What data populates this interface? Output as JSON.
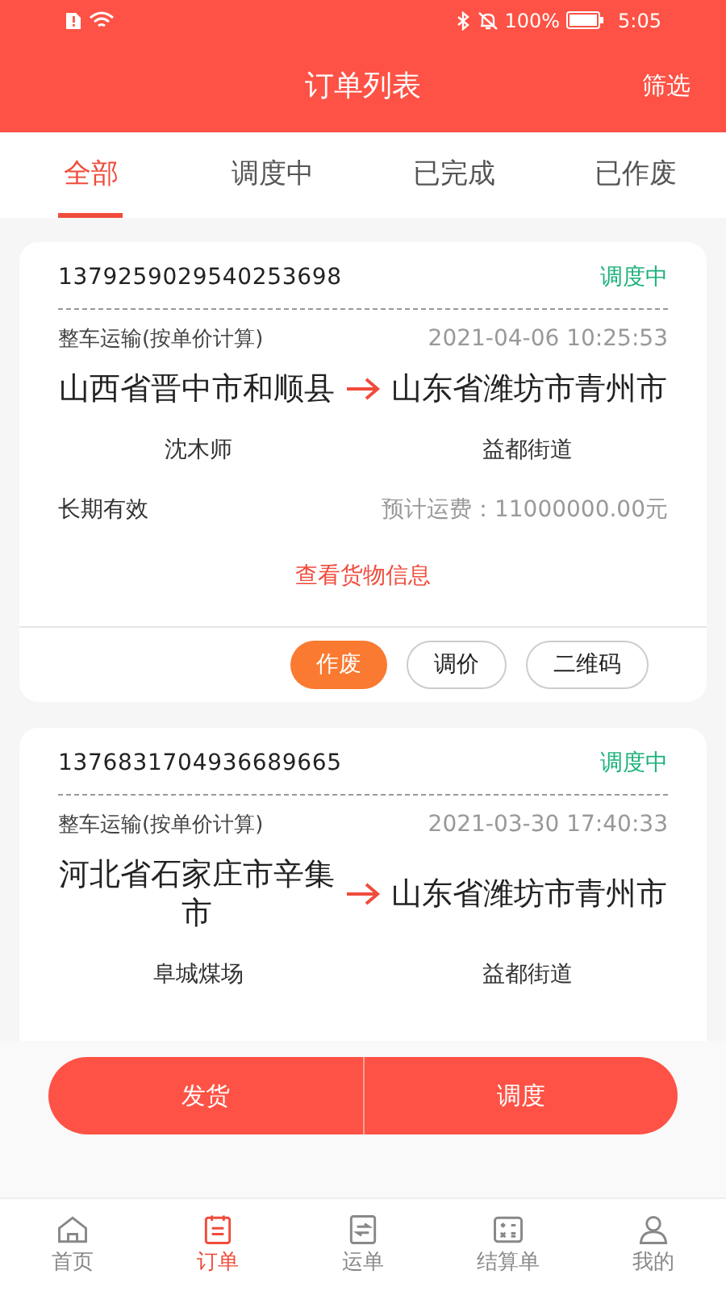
{
  "status_bar": {
    "battery": "100%",
    "time": "5:05"
  },
  "header": {
    "title": "订单列表",
    "action": "筛选"
  },
  "tabs": [
    {
      "label": "全部",
      "selected": true
    },
    {
      "label": "调度中",
      "selected": false
    },
    {
      "label": "已完成",
      "selected": false
    },
    {
      "label": "已作废",
      "selected": false
    }
  ],
  "orders": [
    {
      "number": "1379259029540253698",
      "status": "调度中",
      "type": "整车运输(按单价计算)",
      "time": "2021-04-06 10:25:53",
      "from": "山西省晋中市和顺县",
      "to": "山东省潍坊市青州市",
      "from_place": "沈木师",
      "to_place": "益都街道",
      "validity": "长期有效",
      "fee": "预计运费：11000000.00元",
      "link": "查看货物信息",
      "buttons": [
        {
          "label": "作废",
          "kind": "primary"
        },
        {
          "label": "调价",
          "kind": "outline"
        },
        {
          "label": "二维码",
          "kind": "outline"
        }
      ]
    },
    {
      "number": "1376831704936689665",
      "status": "调度中",
      "type": "整车运输(按单价计算)",
      "time": "2021-03-30 17:40:33",
      "from": "河北省石家庄市辛集市",
      "to": "山东省潍坊市青州市",
      "from_place": "阜城煤场",
      "to_place": "益都街道"
    }
  ],
  "actions": [
    "发货",
    "调度"
  ],
  "nav": [
    {
      "label": "首页",
      "selected": false
    },
    {
      "label": "订单",
      "selected": true
    },
    {
      "label": "运单",
      "selected": false
    },
    {
      "label": "结算单",
      "selected": false
    },
    {
      "label": "我的",
      "selected": false
    }
  ]
}
